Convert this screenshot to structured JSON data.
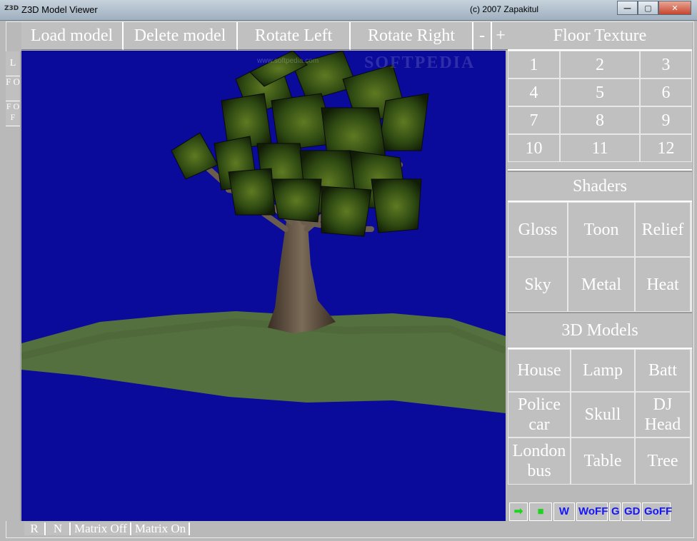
{
  "window": {
    "title": "Z3D Model Viewer",
    "icon_text": "Z3D",
    "copyright": "(c) 2007 Zapakitul",
    "controls": {
      "minimize": "—",
      "maximize": "▢",
      "close": "✕"
    }
  },
  "toolbar": {
    "load": "Load model",
    "delete": "Delete model",
    "rotate_left": "Rotate Left",
    "rotate_right": "Rotate Right",
    "zoom_out": "-",
    "zoom_in": "+"
  },
  "left_buttons": [
    "L",
    "F O",
    "F OF"
  ],
  "viewport": {
    "watermark": "SOFTPEDIA",
    "watermark_url": "www.softpedia.com",
    "background_color": "#0a0a9b",
    "model": "Tree"
  },
  "floor_texture": {
    "title": "Floor Texture",
    "items": [
      "1",
      "2",
      "3",
      "4",
      "5",
      "6",
      "7",
      "8",
      "9",
      "10",
      "11",
      "12"
    ]
  },
  "shaders": {
    "title": "Shaders",
    "items": [
      "Gloss",
      "Toon",
      "Relief",
      "Sky",
      "Metal",
      "Heat"
    ]
  },
  "models": {
    "title": "3D Models",
    "items": [
      "House",
      "Lamp",
      "Batt",
      "Police car",
      "Skull",
      "DJ Head",
      "London bus",
      "Table",
      "Tree"
    ]
  },
  "tools": [
    "➡",
    "■",
    "W",
    "WoFF",
    "G",
    "GD",
    "GoFF"
  ],
  "bottom": {
    "r": "R",
    "n": "N",
    "matrix_off": "Matrix Off",
    "matrix_on": "Matrix On"
  }
}
